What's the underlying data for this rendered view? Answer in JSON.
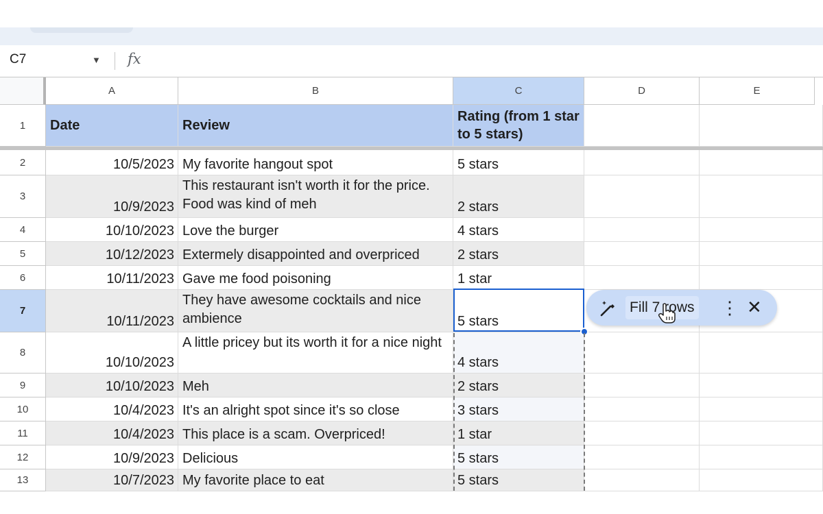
{
  "formula_bar": {
    "cell_ref": "C7",
    "fx_label": "fx"
  },
  "columns": [
    "A",
    "B",
    "C",
    "D",
    "E"
  ],
  "header_row": {
    "row_number": "1",
    "a": "Date",
    "b": "Review",
    "c": "Rating (from 1 star to 5 stars)"
  },
  "rows": [
    {
      "n": "2",
      "date": "10/5/2023",
      "review": "My favorite hangout spot",
      "rating": "5 stars"
    },
    {
      "n": "3",
      "date": "10/9/2023",
      "review": "This restaurant isn't worth it for the price. Food was kind of meh",
      "rating": "2 stars"
    },
    {
      "n": "4",
      "date": "10/10/2023",
      "review": "Love the burger",
      "rating": "4 stars"
    },
    {
      "n": "5",
      "date": "10/12/2023",
      "review": "Extermely disappointed and overpriced",
      "rating": "2 stars"
    },
    {
      "n": "6",
      "date": "10/11/2023",
      "review": "Gave me food poisoning",
      "rating": "1 star"
    },
    {
      "n": "7",
      "date": "10/11/2023",
      "review": "They have awesome cocktails and nice ambience",
      "rating": "5 stars"
    },
    {
      "n": "8",
      "date": "10/10/2023",
      "review": "A little pricey but its worth it for a nice night",
      "rating": "4 stars"
    },
    {
      "n": "9",
      "date": "10/10/2023",
      "review": "Meh",
      "rating": "2 stars"
    },
    {
      "n": "10",
      "date": "10/4/2023",
      "review": "It's an alright spot since it's so close",
      "rating": "3 stars"
    },
    {
      "n": "11",
      "date": "10/4/2023",
      "review": "This place is a scam. Overpriced!",
      "rating": "1 star"
    },
    {
      "n": "12",
      "date": "10/9/2023",
      "review": "Delicious",
      "rating": "5 stars"
    },
    {
      "n": "13",
      "date": "10/7/2023",
      "review": "My favorite place to eat",
      "rating": "5 stars"
    }
  ],
  "smart_fill_chip": {
    "label": "Fill 7 rows",
    "menu_icon": "more-vert-icon",
    "close_icon": "close-icon",
    "wand_icon": "magic-wand-icon"
  },
  "colors": {
    "header_fill": "#b7cdf1",
    "selection_blue": "#1a5fd0",
    "alt_row": "#ebebeb",
    "chip_bg": "#c9dbf7"
  }
}
